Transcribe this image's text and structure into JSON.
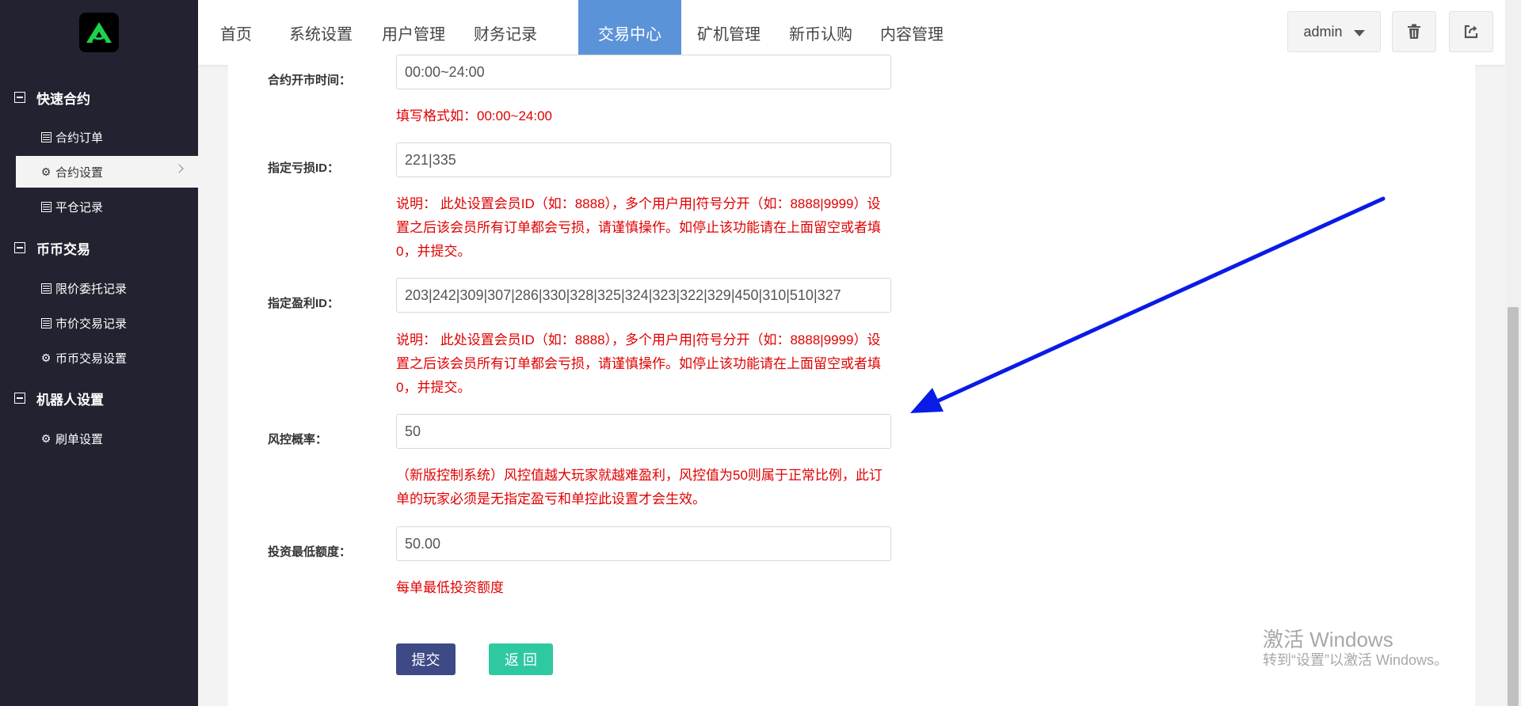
{
  "sidebar": {
    "groups": [
      {
        "label": "快速合约"
      },
      {
        "label": "币币交易"
      },
      {
        "label": "机器人设置"
      }
    ],
    "items": [
      {
        "label": "合约订单",
        "icon": "list-icon"
      },
      {
        "label": "合约设置",
        "icon": "gear-icon"
      },
      {
        "label": "平仓记录",
        "icon": "list-icon"
      },
      {
        "label": "限价委托记录",
        "icon": "list-icon"
      },
      {
        "label": "市价交易记录",
        "icon": "list-icon"
      },
      {
        "label": "币币交易设置",
        "icon": "gear-icon"
      },
      {
        "label": "刷单设置",
        "icon": "gear-icon"
      }
    ]
  },
  "nav": {
    "tabs": [
      "首页",
      "系统设置",
      "用户管理",
      "财务记录",
      "交易中心",
      "矿机管理",
      "新币认购",
      "内容管理"
    ],
    "active": "交易中心",
    "user": "admin"
  },
  "form": {
    "open_time": {
      "label": "合约开市时间：",
      "value": "00:00~24:00",
      "hint": "填写格式如：00:00~24:00"
    },
    "loss_id": {
      "label": "指定亏损ID：",
      "value": "221|335",
      "hint": "说明： 此处设置会员ID（如：8888），多个用户用|符号分开（如：8888|9999）设置之后该会员所有订单都会亏损，请谨慎操作。如停止该功能请在上面留空或者填0，并提交。"
    },
    "profit_id": {
      "label": "指定盈利ID：",
      "value": "203|242|309|307|286|330|328|325|324|323|322|329|450|310|510|327",
      "hint": "说明： 此处设置会员ID（如：8888），多个用户用|符号分开（如：8888|9999）设置之后该会员所有订单都会亏损，请谨慎操作。如停止该功能请在上面留空或者填0，并提交。"
    },
    "risk_rate": {
      "label": "风控概率：",
      "value": "50",
      "hint": "（新版控制系统）风控值越大玩家就越难盈利，风控值为50则属于正常比例，此订单的玩家必须是无指定盈亏和单控此设置才会生效。"
    },
    "min_invest": {
      "label": "投资最低额度：",
      "value": "50.00",
      "hint": "每单最低投资额度"
    },
    "submit_label": "提交",
    "back_label": "返 回"
  },
  "watermark": {
    "line1": "激活 Windows",
    "line2": "转到“设置”以激活 Windows。"
  },
  "colors": {
    "sidebar_bg": "#222230",
    "nav_active": "#5b93d9",
    "hint_red": "#e00000",
    "submit": "#3e4a86",
    "back": "#2ec9a0",
    "arrow": "#0a1be6"
  }
}
